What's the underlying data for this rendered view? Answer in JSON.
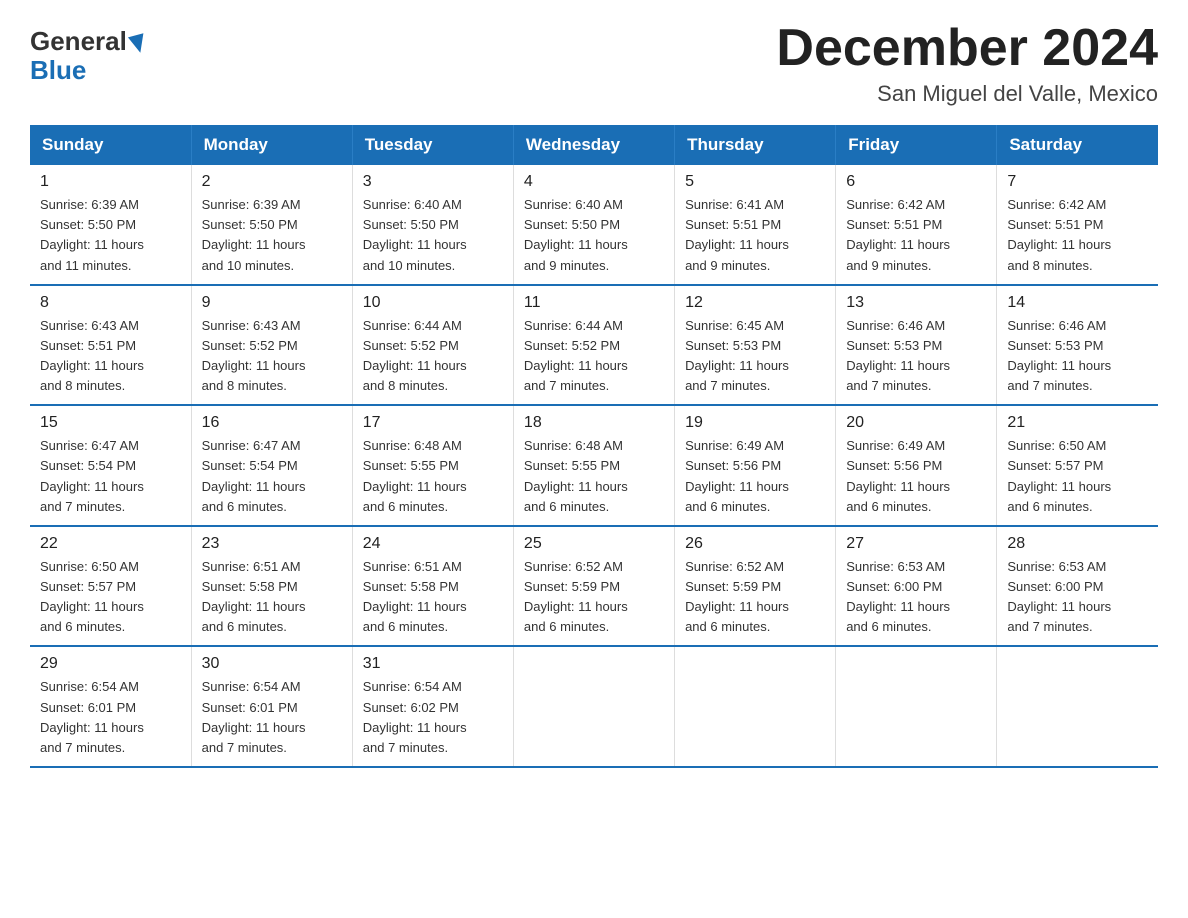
{
  "logo": {
    "general": "General",
    "blue": "Blue",
    "triangle_shape": "▶"
  },
  "header": {
    "month_year": "December 2024",
    "location": "San Miguel del Valle, Mexico"
  },
  "days_of_week": [
    "Sunday",
    "Monday",
    "Tuesday",
    "Wednesday",
    "Thursday",
    "Friday",
    "Saturday"
  ],
  "weeks": [
    [
      {
        "day": "1",
        "sunrise": "6:39 AM",
        "sunset": "5:50 PM",
        "daylight": "11 hours and 11 minutes."
      },
      {
        "day": "2",
        "sunrise": "6:39 AM",
        "sunset": "5:50 PM",
        "daylight": "11 hours and 10 minutes."
      },
      {
        "day": "3",
        "sunrise": "6:40 AM",
        "sunset": "5:50 PM",
        "daylight": "11 hours and 10 minutes."
      },
      {
        "day": "4",
        "sunrise": "6:40 AM",
        "sunset": "5:50 PM",
        "daylight": "11 hours and 9 minutes."
      },
      {
        "day": "5",
        "sunrise": "6:41 AM",
        "sunset": "5:51 PM",
        "daylight": "11 hours and 9 minutes."
      },
      {
        "day": "6",
        "sunrise": "6:42 AM",
        "sunset": "5:51 PM",
        "daylight": "11 hours and 9 minutes."
      },
      {
        "day": "7",
        "sunrise": "6:42 AM",
        "sunset": "5:51 PM",
        "daylight": "11 hours and 8 minutes."
      }
    ],
    [
      {
        "day": "8",
        "sunrise": "6:43 AM",
        "sunset": "5:51 PM",
        "daylight": "11 hours and 8 minutes."
      },
      {
        "day": "9",
        "sunrise": "6:43 AM",
        "sunset": "5:52 PM",
        "daylight": "11 hours and 8 minutes."
      },
      {
        "day": "10",
        "sunrise": "6:44 AM",
        "sunset": "5:52 PM",
        "daylight": "11 hours and 8 minutes."
      },
      {
        "day": "11",
        "sunrise": "6:44 AM",
        "sunset": "5:52 PM",
        "daylight": "11 hours and 7 minutes."
      },
      {
        "day": "12",
        "sunrise": "6:45 AM",
        "sunset": "5:53 PM",
        "daylight": "11 hours and 7 minutes."
      },
      {
        "day": "13",
        "sunrise": "6:46 AM",
        "sunset": "5:53 PM",
        "daylight": "11 hours and 7 minutes."
      },
      {
        "day": "14",
        "sunrise": "6:46 AM",
        "sunset": "5:53 PM",
        "daylight": "11 hours and 7 minutes."
      }
    ],
    [
      {
        "day": "15",
        "sunrise": "6:47 AM",
        "sunset": "5:54 PM",
        "daylight": "11 hours and 7 minutes."
      },
      {
        "day": "16",
        "sunrise": "6:47 AM",
        "sunset": "5:54 PM",
        "daylight": "11 hours and 6 minutes."
      },
      {
        "day": "17",
        "sunrise": "6:48 AM",
        "sunset": "5:55 PM",
        "daylight": "11 hours and 6 minutes."
      },
      {
        "day": "18",
        "sunrise": "6:48 AM",
        "sunset": "5:55 PM",
        "daylight": "11 hours and 6 minutes."
      },
      {
        "day": "19",
        "sunrise": "6:49 AM",
        "sunset": "5:56 PM",
        "daylight": "11 hours and 6 minutes."
      },
      {
        "day": "20",
        "sunrise": "6:49 AM",
        "sunset": "5:56 PM",
        "daylight": "11 hours and 6 minutes."
      },
      {
        "day": "21",
        "sunrise": "6:50 AM",
        "sunset": "5:57 PM",
        "daylight": "11 hours and 6 minutes."
      }
    ],
    [
      {
        "day": "22",
        "sunrise": "6:50 AM",
        "sunset": "5:57 PM",
        "daylight": "11 hours and 6 minutes."
      },
      {
        "day": "23",
        "sunrise": "6:51 AM",
        "sunset": "5:58 PM",
        "daylight": "11 hours and 6 minutes."
      },
      {
        "day": "24",
        "sunrise": "6:51 AM",
        "sunset": "5:58 PM",
        "daylight": "11 hours and 6 minutes."
      },
      {
        "day": "25",
        "sunrise": "6:52 AM",
        "sunset": "5:59 PM",
        "daylight": "11 hours and 6 minutes."
      },
      {
        "day": "26",
        "sunrise": "6:52 AM",
        "sunset": "5:59 PM",
        "daylight": "11 hours and 6 minutes."
      },
      {
        "day": "27",
        "sunrise": "6:53 AM",
        "sunset": "6:00 PM",
        "daylight": "11 hours and 6 minutes."
      },
      {
        "day": "28",
        "sunrise": "6:53 AM",
        "sunset": "6:00 PM",
        "daylight": "11 hours and 7 minutes."
      }
    ],
    [
      {
        "day": "29",
        "sunrise": "6:54 AM",
        "sunset": "6:01 PM",
        "daylight": "11 hours and 7 minutes."
      },
      {
        "day": "30",
        "sunrise": "6:54 AM",
        "sunset": "6:01 PM",
        "daylight": "11 hours and 7 minutes."
      },
      {
        "day": "31",
        "sunrise": "6:54 AM",
        "sunset": "6:02 PM",
        "daylight": "11 hours and 7 minutes."
      },
      null,
      null,
      null,
      null
    ]
  ],
  "labels": {
    "sunrise": "Sunrise:",
    "sunset": "Sunset:",
    "daylight": "Daylight:"
  }
}
